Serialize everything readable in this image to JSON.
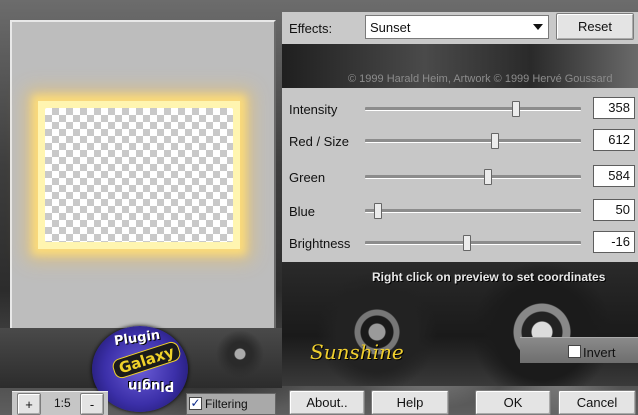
{
  "effects": {
    "label": "Effects:",
    "selected": "Sunset"
  },
  "toolbar": {
    "reset_label": "Reset"
  },
  "copyright": "© 1999 Harald Heim, Artwork © 1999 Hervé Goussard",
  "sliders": [
    {
      "label": "Intensity",
      "value": "358",
      "position": 0.7
    },
    {
      "label": "Red / Size",
      "value": "612",
      "position": 0.6
    },
    {
      "label": "Green",
      "value": "584",
      "position": 0.57
    },
    {
      "label": "Blue",
      "value": "50",
      "position": 0.06
    },
    {
      "label": "Brightness",
      "value": "-16",
      "position": 0.47
    }
  ],
  "hint": "Right click on preview to set coordinates",
  "logo": {
    "top": "Plugin",
    "middle": "Galaxy",
    "bottom": "Plugin"
  },
  "wordmark": "Sunshine",
  "invert": {
    "label": "Invert",
    "checked": false
  },
  "zoom": {
    "plus": "+",
    "level": "1:5",
    "minus": "-"
  },
  "filtering": {
    "label": "Filtering",
    "checked": true
  },
  "buttons": {
    "about": "About..",
    "help": "Help",
    "ok": "OK",
    "cancel": "Cancel"
  },
  "colors": {
    "glow": "#ffd970",
    "panel": "#c7c7c7",
    "wordmark": "#f0cf2e",
    "badge": "#3b2fa8"
  }
}
